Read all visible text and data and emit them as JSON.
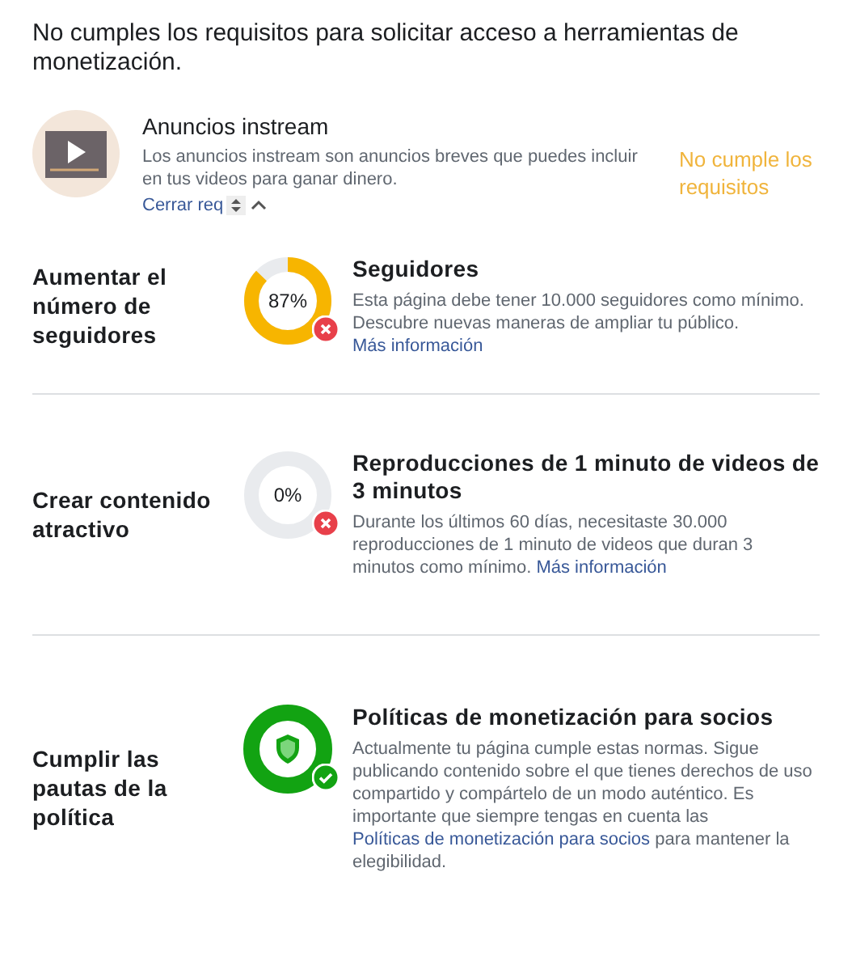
{
  "header": "No cumples los requisitos para solicitar acceso a herramientas de monetización.",
  "tool": {
    "title": "Anuncios instream",
    "description": "Los anuncios instream son anuncios breves que puedes incluir en tus videos para ganar dinero.",
    "link": "Cerrar req",
    "status": "No cumple los requisitos",
    "expanded": true
  },
  "requirements": [
    {
      "label": "Aumentar el número de seguidores",
      "kind": "progress",
      "reading": "87%",
      "met": false,
      "title": "Seguidores",
      "text": "Esta página debe tener 10.000 seguidores como mínimo. Descubre nuevas maneras de ampliar tu público.",
      "link": "Más información"
    },
    {
      "label": "Crear contenido atractivo",
      "kind": "progress",
      "reading": "0%",
      "met": false,
      "title": "Reproducciones de 1 minuto de videos de 3 minutos",
      "text": "Durante los últimos 60 días, necesitaste 30.000 reproducciones de 1 minuto de videos que duran 3 minutos como mínimo.",
      "link": "Más información"
    },
    {
      "label": "Cumplir las pautas de la política",
      "kind": "policy",
      "met": true,
      "title": "Políticas de monetización para socios",
      "text": "Actualmente tu página cumple estas normas. Sigue publicando contenido sobre el que tienes derechos de uso compartido y compártelo de un modo auténtico. Es importante que siempre tengas en cuenta las",
      "link": "Políticas de monetización para socios",
      "text_after": "para mantener la elegibilidad."
    }
  ]
}
